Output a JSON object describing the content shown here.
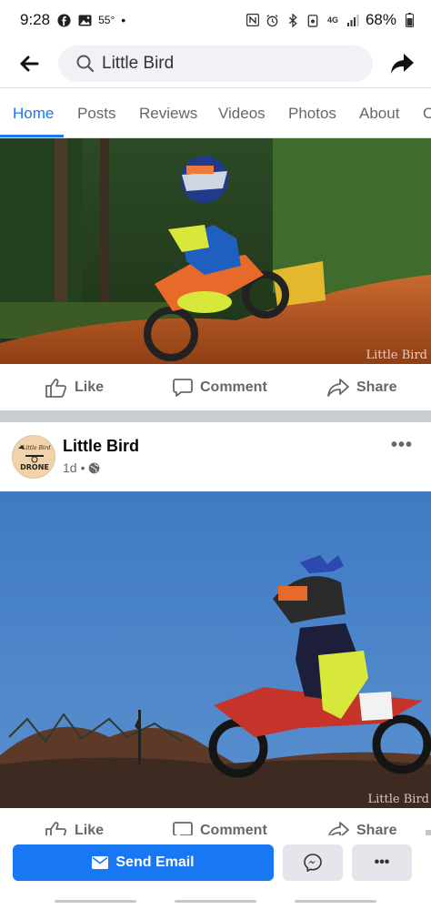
{
  "status_bar": {
    "time": "9:28",
    "temperature": "55°",
    "dot": "•",
    "battery": "68%",
    "icons": [
      "facebook-notification-icon",
      "gallery-notification-icon",
      "nfc-icon",
      "alarm-icon",
      "bluetooth-icon",
      "data-saver-icon",
      "4g-lte-icon",
      "signal-icon",
      "battery-icon"
    ]
  },
  "top_bar": {
    "search_text": "Little Bird",
    "back_icon": "arrow-left-icon",
    "share_icon": "share-arrow-icon"
  },
  "tabs": [
    {
      "label": "Home",
      "active": true
    },
    {
      "label": "Posts",
      "active": false
    },
    {
      "label": "Reviews",
      "active": false
    },
    {
      "label": "Videos",
      "active": false
    },
    {
      "label": "Photos",
      "active": false
    },
    {
      "label": "About",
      "active": false
    },
    {
      "label": "C",
      "active": false
    }
  ],
  "post1": {
    "watermark": "Little Bird",
    "actions": {
      "like": "Like",
      "comment": "Comment",
      "share": "Share"
    }
  },
  "post2": {
    "page_name": "Little Bird",
    "time": "1d",
    "meta_sep": "•",
    "more": "•••",
    "avatar_text": "Little Bird",
    "avatar_brand": "DRONE",
    "watermark": "Little Bird",
    "actions": {
      "like": "Like",
      "comment": "Comment",
      "share": "Share"
    }
  },
  "bottom_bar": {
    "send_email": "Send Email",
    "more": "•••",
    "messenger_icon": "messenger-icon"
  },
  "colors": {
    "accent": "#1877f2",
    "secondary_text": "#65676b",
    "button_gray": "#e4e6eb",
    "divider": "#c9ccd1"
  }
}
